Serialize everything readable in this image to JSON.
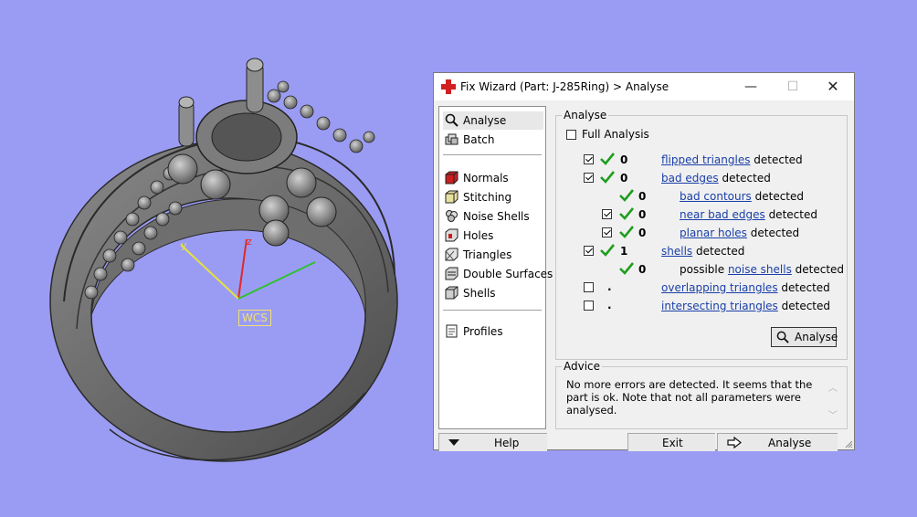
{
  "viewport": {
    "wcs_label": "WCS",
    "z_label": "z",
    "y_label": "y"
  },
  "dialog": {
    "title": "Fix Wizard (Part: J-285Ring) > Analyse",
    "title_icon": "red-cross-icon",
    "window_buttons": {
      "minimize": "—",
      "maximize": "☐",
      "close": "✕"
    }
  },
  "nav": {
    "items": [
      {
        "label": "Analyse",
        "icon": "magnifier-icon",
        "selected": true
      },
      {
        "label": "Batch",
        "icon": "batch-icon"
      },
      {
        "label": "Normals",
        "icon": "cube-red-icon"
      },
      {
        "label": "Stitching",
        "icon": "cube-stitch-icon"
      },
      {
        "label": "Noise Shells",
        "icon": "noise-shells-icon"
      },
      {
        "label": "Holes",
        "icon": "holes-icon"
      },
      {
        "label": "Triangles",
        "icon": "triangles-icon"
      },
      {
        "label": "Double Surfaces",
        "icon": "double-surfaces-icon"
      },
      {
        "label": "Shells",
        "icon": "shells-icon"
      },
      {
        "label": "Profiles",
        "icon": "profiles-icon"
      }
    ]
  },
  "analyse": {
    "group_title": "Analyse",
    "full_analysis_label": "Full Analysis",
    "full_analysis_checked": false,
    "rows": [
      {
        "checked": true,
        "ok": true,
        "value": "0",
        "link": "flipped triangles",
        "prefix": "",
        "suffix": " detected"
      },
      {
        "checked": true,
        "ok": true,
        "value": "0",
        "link": "bad edges",
        "prefix": "",
        "suffix": " detected"
      },
      {
        "checked": null,
        "ok": true,
        "value": "0",
        "link": "bad contours",
        "prefix": "",
        "suffix": " detected"
      },
      {
        "checked": true,
        "ok": true,
        "value": "0",
        "link": "near bad edges",
        "prefix": "",
        "suffix": " detected"
      },
      {
        "checked": true,
        "ok": true,
        "value": "0",
        "link": "planar holes",
        "prefix": "",
        "suffix": " detected"
      },
      {
        "checked": true,
        "ok": true,
        "value": "1",
        "link": "shells",
        "prefix": "",
        "suffix": " detected"
      },
      {
        "checked": null,
        "ok": true,
        "value": "0",
        "link": "noise shells",
        "prefix": "possible ",
        "suffix": " detected"
      },
      {
        "checked": false,
        "ok": false,
        "value": ".",
        "link": "overlapping triangles",
        "prefix": "",
        "suffix": " detected"
      },
      {
        "checked": false,
        "ok": false,
        "value": ".",
        "link": "intersecting triangles",
        "prefix": "",
        "suffix": " detected"
      }
    ],
    "button_label": "Analyse"
  },
  "advice": {
    "group_title": "Advice",
    "text": "No more errors are detected. It seems that the part is ok. Note that not all parameters were analysed."
  },
  "bottom": {
    "help_label": "Help",
    "exit_label": "Exit",
    "analyse_label": "Analyse"
  },
  "colors": {
    "background": "#9a9cf3",
    "link": "#1a3fa8",
    "tick": "#1e9e1e"
  }
}
